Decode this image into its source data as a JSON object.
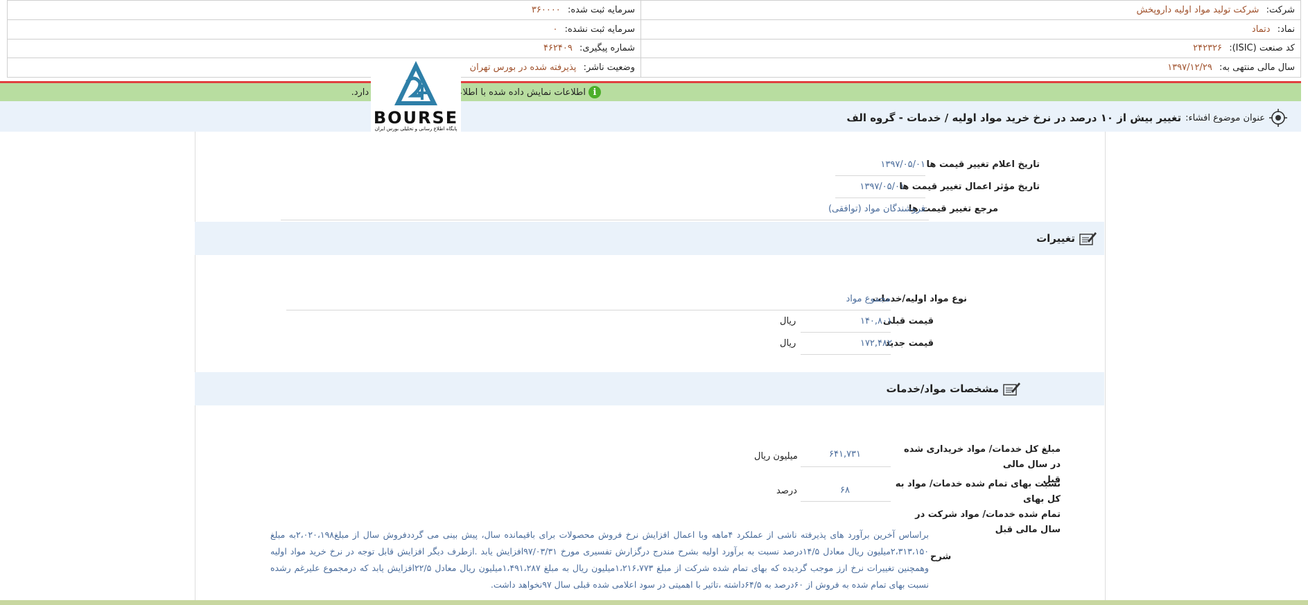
{
  "header": {
    "company_label": "شرکت:",
    "company_value": "شرکت تولید مواد اولیه داروپخش",
    "capital_reg_label": "سرمایه ثبت شده:",
    "capital_reg_value": "۳۶۰۰۰۰",
    "symbol_label": "نماد:",
    "symbol_value": "دتماد",
    "capital_unreg_label": "سرمایه ثبت نشده:",
    "capital_unreg_value": "۰",
    "isic_label": "کد صنعت (ISIC):",
    "isic_value": "۲۴۲۳۲۶",
    "tracking_label": "شماره پیگیری:",
    "tracking_value": "۴۶۲۴۰۹",
    "fiscal_label": "سال مالی منتهی به:",
    "fiscal_value": "۱۳۹۷/۱۲/۲۹",
    "status_label": "وضعیت ناشر:",
    "status_value": "پذیرفته شده در بورس تهران"
  },
  "notice": {
    "info_icon": "i",
    "text": "اطلاعات نمایش داده شده با اطلاعات امضا شده مطابقت دارد."
  },
  "subject": {
    "label": "عنوان موضوع افشاء:",
    "title": "تغییر بیش از ۱۰ درصد در نرخ خرید مواد اولیه / خدمات - گروه الف"
  },
  "logo": {
    "text": "BOURSE",
    "subtitle": "پایگاه اطلاع رسانی و تحلیلی بورس ایران"
  },
  "dates": {
    "announce_label": "تاریخ اعلام تغییر قیمت ها",
    "announce_value": "۱۳۹۷/۰۵/۰۱",
    "effective_label": "تاریخ مؤثر اعمال تغییر قیمت ها",
    "effective_value": "۱۳۹۷/۰۵/۰۱",
    "reference_label": "مرجع تغییر قیمت ها",
    "reference_value": "فروشندگان مواد (توافقی)"
  },
  "changes": {
    "section_title": "تغییرات",
    "type_label": "نوع مواد اولیه/خدمات",
    "type_value": "مجموع مواد",
    "old_price_label": "قیمت قبلی",
    "old_price_value": "۱۴۰,۸۰۱",
    "new_price_label": "قیمت جدید",
    "new_price_value": "۱۷۲,۴۸۲",
    "currency": "ریال"
  },
  "specs": {
    "section_title": "مشخصات مواد/خدمات",
    "total_label_1": "مبلغ کل خدمات/ مواد خریداری شده در سال مالی",
    "total_label_2": "قبل",
    "total_value": "۶۴۱,۷۳۱",
    "total_unit": "میلیون ریال",
    "ratio_label_1": "نسبت بهای تمام شده خدمات/ مواد به کل بهای",
    "ratio_label_2": "تمام شده خدمات/ مواد شرکت در سال مالی قبل",
    "ratio_value": "۶۸",
    "ratio_unit": "درصد"
  },
  "description": {
    "label": "شرح",
    "text": "براساس آخرین برآورد های پذیرفته ناشی از عملکرد ۴ماهه وبا اعمال افزایش نرخ فروش محصولات برای باقیمانده سال، پیش بینی می گرددفروش سال از مبلغ۲،۰۲۰،۱۹۸به مبلغ ۲،۳۱۳،۱۵۰میلیون ریال معادل ۱۴/۵درصد نسبت به برآورد اولیه بشرح مندرج درگزارش تفسیری مورخ ۹۷/۰۳/۳۱افزایش یابد .ازطرف دیگر افزایش قابل توجه در نرخ خرید مواد اولیه وهمچنین تغییرات نرخ ارز موجب گردیده که بهای تمام شده شرکت از مبلغ ۱،۲۱۶،۷۷۳میلیون ریال به مبلغ ۱،۴۹۱،۲۸۷میلیون ریال معادل ۲۲/۵افزایش یابد که درمجموع علیرغم رشده نسبت بهای تمام شده به فروش از ۶۰درصد به ۶۴/۵داشته ،تاثیر با اهمیتی در سود اعلامی شده قبلی سال ۹۷نخواهد داشت."
  },
  "colors": {
    "accent_green": "#b8dda0",
    "accent_red": "#e04040",
    "value_brown": "#a0522d",
    "value_blue": "#4a6c9b"
  }
}
